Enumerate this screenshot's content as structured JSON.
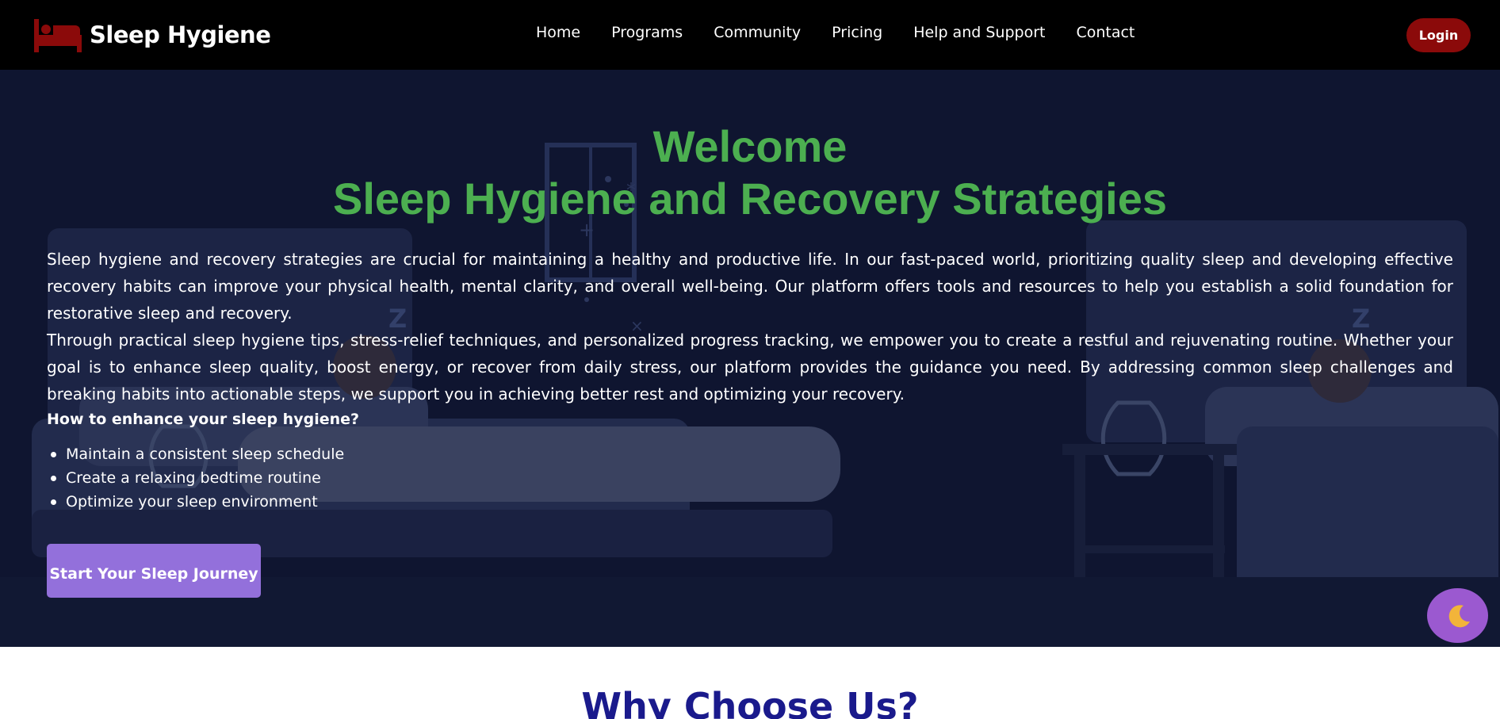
{
  "brand": {
    "name": "Sleep Hygiene",
    "icon": "bed-icon",
    "accent": "#8b0a0a"
  },
  "nav": {
    "links": [
      {
        "label": "Home"
      },
      {
        "label": "Programs"
      },
      {
        "label": "Community"
      },
      {
        "label": "Pricing"
      },
      {
        "label": "Help and Support"
      },
      {
        "label": "Contact"
      }
    ],
    "login_label": "Login"
  },
  "hero": {
    "title_line1": "Welcome",
    "title_line2": "Sleep Hygiene and Recovery Strategies",
    "title_color": "#4caf50",
    "paragraph1": "Sleep hygiene and recovery strategies are crucial for maintaining a healthy and productive life. In our fast-paced world, prioritizing quality sleep and developing effective recovery habits can improve your physical health, mental clarity, and overall well-being. Our platform offers tools and resources to help you establish a solid foundation for restorative sleep and recovery.",
    "paragraph2": "Through practical sleep hygiene tips, stress-relief techniques, and personalized progress tracking, we empower you to create a restful and rejuvenating routine. Whether your goal is to enhance sleep quality, boost energy, or recover from daily stress, our platform provides the guidance you need. By addressing common sleep challenges and breaking habits into actionable steps, we support you in achieving better rest and optimizing your recovery.",
    "question": "How to enhance your sleep hygiene?",
    "tips": [
      "Maintain a consistent sleep schedule",
      "Create a relaxing bedtime routine",
      "Optimize your sleep environment"
    ],
    "cta_label": "Start Your Sleep Journey",
    "cta_color": "#9370db"
  },
  "theme_toggle": {
    "icon": "moon-icon"
  },
  "why": {
    "title": "Why Choose Us?"
  }
}
